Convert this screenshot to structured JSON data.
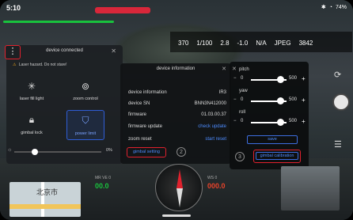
{
  "status": {
    "time": "5:10",
    "right_text": "74%"
  },
  "camera_settings": {
    "values": [
      "370",
      "1/100",
      "2.8",
      "-1.0",
      "N/A",
      "JPEG",
      "3842"
    ]
  },
  "left_panel": {
    "title": "device connected",
    "warning": "Laser hazard. Do not stare!",
    "tiles": [
      {
        "label": "laser fill light",
        "icon": "sparkle-icon"
      },
      {
        "label": "zoom control",
        "icon": "zoom-icon"
      },
      {
        "label": "gimbal lock",
        "icon": "lock-icon"
      },
      {
        "label": "power limit",
        "icon": "shield-icon"
      }
    ],
    "slider_value": "0%",
    "colors": {
      "accent": "#2f5dd6"
    }
  },
  "device_info": {
    "title": "device information",
    "rows": [
      {
        "label": "device information",
        "value": "IR3"
      },
      {
        "label": "device SN",
        "value": "BNN3N412000"
      },
      {
        "label": "firmware",
        "value": "01.03.00.37"
      },
      {
        "label": "firmware update",
        "value": "check update"
      },
      {
        "label": "zoom reset",
        "value": "start reset"
      }
    ],
    "gimbal_setting": "gimbal setting",
    "step": "2"
  },
  "gimbal_panel": {
    "axes": [
      {
        "label": "pitch",
        "min": "0",
        "max": "500"
      },
      {
        "label": "yaw",
        "min": "0",
        "max": "500"
      },
      {
        "label": "roll",
        "min": "0",
        "max": "500"
      }
    ],
    "save": "save",
    "calibration": "gimbal calibration",
    "step": "3"
  },
  "telemetry": {
    "left_label": "MR VE 0",
    "left_value": "00.0",
    "right_label": "WS 0",
    "right_value": "000.0"
  },
  "map": {
    "city": "北京市"
  },
  "colors": {
    "highlight_red": "#e0212d",
    "link_blue": "#4d8cff",
    "ok_green": "#19c23d"
  }
}
